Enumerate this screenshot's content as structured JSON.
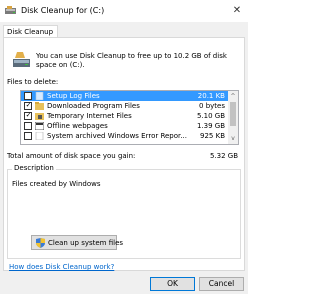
{
  "window": {
    "title": "Disk Cleanup for  (C:)",
    "icon": "disk-cleanup-icon",
    "close_glyph": "✕"
  },
  "tabs": [
    {
      "label": "Disk Cleanup",
      "active": true
    }
  ],
  "intro": {
    "text": "You can use Disk Cleanup to free up to 10.2 GB of disk space on  (C:)."
  },
  "files_label": "Files to delete:",
  "files": [
    {
      "name": "Setup Log Files",
      "size": "20.1 KB",
      "checked": false,
      "selected": true,
      "icon": "file-icon"
    },
    {
      "name": "Downloaded Program Files",
      "size": "0 bytes",
      "checked": true,
      "selected": false,
      "icon": "folder-icon"
    },
    {
      "name": "Temporary Internet Files",
      "size": "5.10 GB",
      "checked": true,
      "selected": false,
      "icon": "lock-folder-icon"
    },
    {
      "name": "Offline webpages",
      "size": "1.39 GB",
      "checked": false,
      "selected": false,
      "icon": "webpage-icon"
    },
    {
      "name": "System archived Windows Error Repor...",
      "size": "925 KB",
      "checked": false,
      "selected": false,
      "icon": "file-icon"
    }
  ],
  "scroll": {
    "up_glyph": "^",
    "down_glyph": "v"
  },
  "total": {
    "label": "Total amount of disk space you gain:",
    "value": "5.32 GB"
  },
  "description": {
    "legend": "Description",
    "text": "Files created by Windows"
  },
  "cleanup_button": {
    "label": "Clean up system files",
    "icon": "shield-icon"
  },
  "help_link": "How does Disk Cleanup work?",
  "buttons": {
    "ok": "OK",
    "cancel": "Cancel"
  },
  "colors": {
    "selection": "#3399ff",
    "link": "#0066cc",
    "accent_border": "#0078d7"
  }
}
